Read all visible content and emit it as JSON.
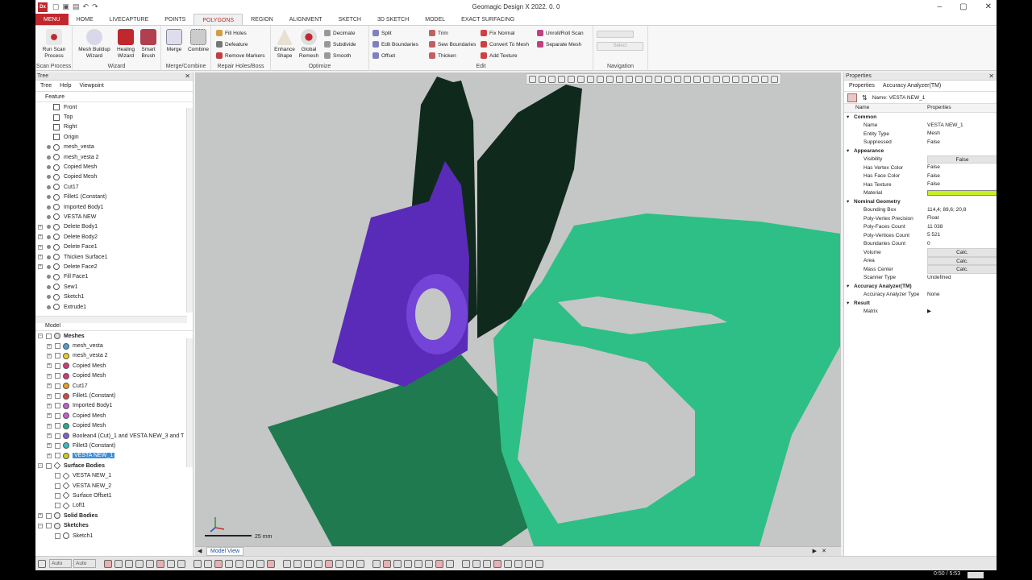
{
  "window": {
    "title": "Geomagic Design X 2022. 0. 0",
    "logo": "Dx"
  },
  "tabs": [
    "MENU",
    "HOME",
    "LIVECAPTURE",
    "POINTS",
    "POLYGONS",
    "REGION",
    "ALIGNMENT",
    "SKETCH",
    "3D SKETCH",
    "MODEL",
    "EXACT SURFACING"
  ],
  "ribbon": {
    "groups": [
      "Scan Process",
      "Wizard",
      "Merge/Combine",
      "Repair Holes/Boss",
      "Optimize",
      "Edit",
      "Navigation"
    ],
    "run_scan": "Run Scan Process",
    "mesh_buildup": "Mesh Buildup Wizard",
    "healing": "Healing Wizard",
    "smart_brush": "Smart Brush",
    "merge": "Merge",
    "combine": "Combine",
    "fill_holes": "Fill Holes",
    "defeature": "Defeature",
    "remove_markers": "Remove Markers",
    "enhance_shape": "Enhance Shape",
    "global_remesh": "Global Remesh",
    "decimate": "Decimate",
    "subdivide": "Subdivide",
    "smooth": "Smooth",
    "split": "Split",
    "edit_boundaries": "Edit Boundaries",
    "offset": "Offset",
    "trim": "Trim",
    "sew_boundaries": "Sew Boundaries",
    "thicken": "Thicken",
    "fix_normal": "Fix Normal",
    "convert_to_mesh": "Convert To Mesh",
    "add_texture": "Add Texture",
    "unroll": "Unroll/Roll Scan",
    "separate_mesh": "Separate Mesh",
    "nav_select": "Select"
  },
  "tree": {
    "title": "Tree",
    "subtabs": [
      "Tree",
      "Help",
      "Viewpoint"
    ],
    "feature_header": "Feature",
    "features": [
      "Front",
      "Top",
      "Right",
      "Origin",
      "mesh_vesta",
      "mesh_vesta 2",
      "Copied Mesh",
      "Copied Mesh",
      "Cut17",
      "Fillet1 (Constant)",
      "Imported Body1",
      "VESTA NEW",
      "Delete Body1",
      "Delete Body2",
      "Delete Face1",
      "Thicken Surface1",
      "Delete Face2",
      "Fill Face1",
      "Sew1",
      "Sketch1",
      "Extrude1"
    ],
    "model_header": "Model",
    "meshes_label": "Meshes",
    "meshes": [
      "mesh_vesta",
      "mesh_vesta 2",
      "Copied Mesh",
      "Copied Mesh",
      "Cut17",
      "Fillet1 (Constant)",
      "Imported Body1",
      "Copied Mesh",
      "Copied Mesh",
      "Boolean4 (Cut)_1 and VESTA NEW_3 and T",
      "Fillet3 (Constant)",
      "VESTA NEW_1"
    ],
    "mesh_colors": [
      "#4aa0d8",
      "#e8d020",
      "#d23a7a",
      "#d23a7a",
      "#e8a020",
      "#d04a4a",
      "#c060d0",
      "#c060d0",
      "#20b090",
      "#8060d0",
      "#30c0c0",
      "#c8d020"
    ],
    "surface_label": "Surface Bodies",
    "surfaces": [
      "VESTA NEW_1",
      "VESTA NEW_2",
      "Surface Offset1",
      "Loft1"
    ],
    "solid_label": "Solid Bodies",
    "sketches_label": "Sketches",
    "sketches": [
      "Sketch1"
    ]
  },
  "viewport": {
    "scale_label": "25 mm",
    "tab": "Model View"
  },
  "properties": {
    "title": "Properties",
    "tabs": [
      "Properties",
      "Accuracy Analyzer(TM)"
    ],
    "name_line": "Name: VESTA NEW_1",
    "col_name": "Name",
    "col_props": "Properties",
    "rows": [
      {
        "cat": true,
        "name": "Common",
        "value": ""
      },
      {
        "name": "Name",
        "value": "VESTA NEW_1"
      },
      {
        "name": "Entity Type",
        "value": "Mesh"
      },
      {
        "name": "Suppressed",
        "value": "False"
      },
      {
        "cat": true,
        "name": "Appearance",
        "value": ""
      },
      {
        "name": "Visibility",
        "value": "False",
        "btn": true
      },
      {
        "name": "Has Vertex Color",
        "value": "False"
      },
      {
        "name": "Has Face Color",
        "value": "False"
      },
      {
        "name": "Has Texture",
        "value": "False"
      },
      {
        "name": "Material",
        "value": "",
        "swatch": "#c8f020"
      },
      {
        "cat": true,
        "name": "Nominal Geometry",
        "value": ""
      },
      {
        "name": "Bounding Box",
        "value": "114,4; 89,6; 20,8"
      },
      {
        "name": "Poly-Vertex Precision",
        "value": "Float"
      },
      {
        "name": "Poly-Faces Count",
        "value": "11 038"
      },
      {
        "name": "Poly-Vertices Count",
        "value": "5 521"
      },
      {
        "name": "Boundaries Count",
        "value": "0"
      },
      {
        "name": "Volume",
        "value": "Calc.",
        "btn": true
      },
      {
        "name": "Area",
        "value": "Calc.",
        "btn": true
      },
      {
        "name": "Mass Center",
        "value": "Calc.",
        "btn": true
      },
      {
        "name": "Scanner Type",
        "value": "Undefined"
      },
      {
        "cat": true,
        "name": "Accuracy Analyzer(TM)",
        "value": ""
      },
      {
        "name": "Accuracy Analyzer Type",
        "value": "None"
      },
      {
        "cat": true,
        "name": "Result",
        "value": ""
      },
      {
        "name": "Matrix",
        "value": "▶"
      }
    ]
  },
  "status": {
    "auto1": "Auto",
    "auto2": "Auto",
    "time": "0:50 / 5:53"
  }
}
